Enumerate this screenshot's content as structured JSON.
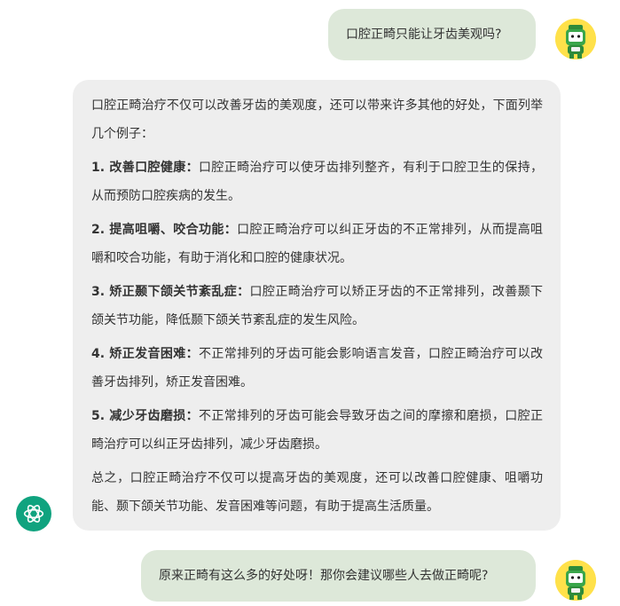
{
  "conversation": {
    "user_message_1": "口腔正畸只能让牙齿美观吗?",
    "assistant": {
      "intro": "口腔正畸治疗不仅可以改善牙齿的美观度，还可以带来许多其他的好处，下面列举几个例子：",
      "points": [
        {
          "title": "1. 改善口腔健康：",
          "text": "口腔正畸治疗可以使牙齿排列整齐，有利于口腔卫生的保持，从而预防口腔疾病的发生。"
        },
        {
          "title": "2. 提高咀嚼、咬合功能：",
          "text": "口腔正畸治疗可以纠正牙齿的不正常排列，从而提高咀嚼和咬合功能，有助于消化和口腔的健康状况。"
        },
        {
          "title": "3. 矫正颞下颌关节紊乱症：",
          "text": "口腔正畸治疗可以矫正牙齿的不正常排列，改善颞下颌关节功能，降低颞下颌关节紊乱症的发生风险。"
        },
        {
          "title": "4. 矫正发音困难：",
          "text": "不正常排列的牙齿可能会影响语言发音，口腔正畸治疗可以改善牙齿排列，矫正发音困难。"
        },
        {
          "title": "5. 减少牙齿磨损：",
          "text": "不正常排列的牙齿可能会导致牙齿之间的摩擦和磨损，口腔正畸治疗可以纠正牙齿排列，减少牙齿磨损。"
        }
      ],
      "summary": "总之，口腔正畸治疗不仅可以提高牙齿的美观度，还可以改善口腔健康、咀嚼功能、颞下颌关节功能、发音困难等问题，有助于提高生活质量。"
    },
    "user_message_2": "原来正畸有这么多的好处呀！那你会建议哪些人去做正畸呢?"
  },
  "icons": {
    "user_avatar": "robot-mascot-avatar-icon",
    "assistant_avatar": "openai-logo-icon"
  },
  "colors": {
    "user_bubble": "#dde8d9",
    "assistant_bubble": "#eeeeee",
    "assistant_avatar_bg": "#10a37f",
    "user_avatar_bg": "#ffe14a"
  }
}
